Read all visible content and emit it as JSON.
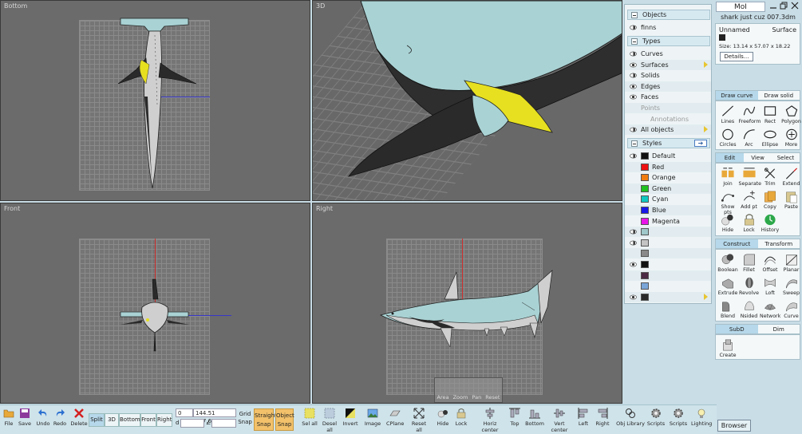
{
  "viewports": {
    "bottom": {
      "label": "Bottom"
    },
    "persp": {
      "label": "3D"
    },
    "front": {
      "label": "Front"
    },
    "right": {
      "label": "Right"
    }
  },
  "view_controls": [
    "Area",
    "Zoom",
    "Pan",
    "Reset"
  ],
  "toolbar": {
    "file": "File",
    "save": "Save",
    "undo": "Undo",
    "redo": "Redo",
    "delete": "Delete",
    "views": [
      "Split",
      "3D",
      "Bottom",
      "Front",
      "Right"
    ],
    "coords": {
      "x": "0",
      "yz": "144.51  197.67",
      "d": "d",
      "angle_sym": "∠"
    },
    "grid_snap": [
      "Grid",
      "Snap"
    ],
    "straight_snap": [
      "Straight",
      "Snap"
    ],
    "object_snap": [
      "Object",
      "Snap"
    ],
    "sel_all": "Sel all",
    "desel_all": "Desel all",
    "invert": "Invert",
    "image": "Image",
    "cplane": "CPlane",
    "reset_all": "Reset all",
    "hide": "Hide",
    "lock": "Lock",
    "horiz_center": "Horiz center",
    "top": "Top",
    "bottom": "Bottom",
    "vert_center": "Vert center",
    "left": "Left",
    "right": "Right",
    "obj_library": "Obj Library",
    "scripts1": "Scripts",
    "scripts2": "Scripts",
    "lighting": "Lighting"
  },
  "browser": {
    "objects_header": "Objects",
    "objects": [
      "finns"
    ],
    "types_header": "Types",
    "types": [
      "Curves",
      "Surfaces",
      "Solids",
      "Edges",
      "Faces",
      "Points",
      "Annotations",
      "All objects"
    ],
    "styles_header": "Styles",
    "styles": [
      {
        "name": "Default",
        "color": "#111111"
      },
      {
        "name": "Red",
        "color": "#ee1111"
      },
      {
        "name": "Orange",
        "color": "#f07c10"
      },
      {
        "name": "Green",
        "color": "#1fc01f"
      },
      {
        "name": "Cyan",
        "color": "#10c8c0"
      },
      {
        "name": "Blue",
        "color": "#1818e8"
      },
      {
        "name": "Magenta",
        "color": "#e814e8"
      },
      {
        "name": "",
        "color": "#9fc8ca"
      },
      {
        "name": "",
        "color": "#c4c4c4"
      },
      {
        "name": "",
        "color": "#8a8a8a"
      },
      {
        "name": "",
        "color": "#111111"
      },
      {
        "name": "",
        "color": "#4a2a44"
      },
      {
        "name": "",
        "color": "#7aa6d8"
      },
      {
        "name": "",
        "color": "#2a2a2a"
      }
    ]
  },
  "panel": {
    "app_name": "MoI",
    "file_name": "shark just cuz 007.3dm",
    "object_name": "Unnamed",
    "object_type": "Surface",
    "size": "Size: 13.14 x 57.07 x 18.22",
    "details": "Details...",
    "draw_tabs": [
      "Draw curve",
      "Draw solid"
    ],
    "draw_cmds": [
      "Lines",
      "Freeform",
      "Rect",
      "Polygon",
      "Circles",
      "Arc",
      "Ellipse",
      "More"
    ],
    "edit_tabs": [
      "Edit",
      "View",
      "Select"
    ],
    "edit_cmds": [
      "Join",
      "Separate",
      "Trim",
      "Extend",
      "Show pts",
      "Add pt",
      "Copy",
      "Paste",
      "Hide",
      "Lock",
      "History"
    ],
    "construct_tabs": [
      "Construct",
      "Transform"
    ],
    "construct_cmds": [
      "Boolean",
      "Fillet",
      "Offset",
      "Planar",
      "Extrude",
      "Revolve",
      "Loft",
      "Sweep",
      "Blend",
      "Nsided",
      "Network",
      "Curve"
    ],
    "subd_tabs": [
      "SubD",
      "Dim"
    ],
    "subd_cmds": [
      "Create"
    ],
    "browser_button": "Browser"
  }
}
